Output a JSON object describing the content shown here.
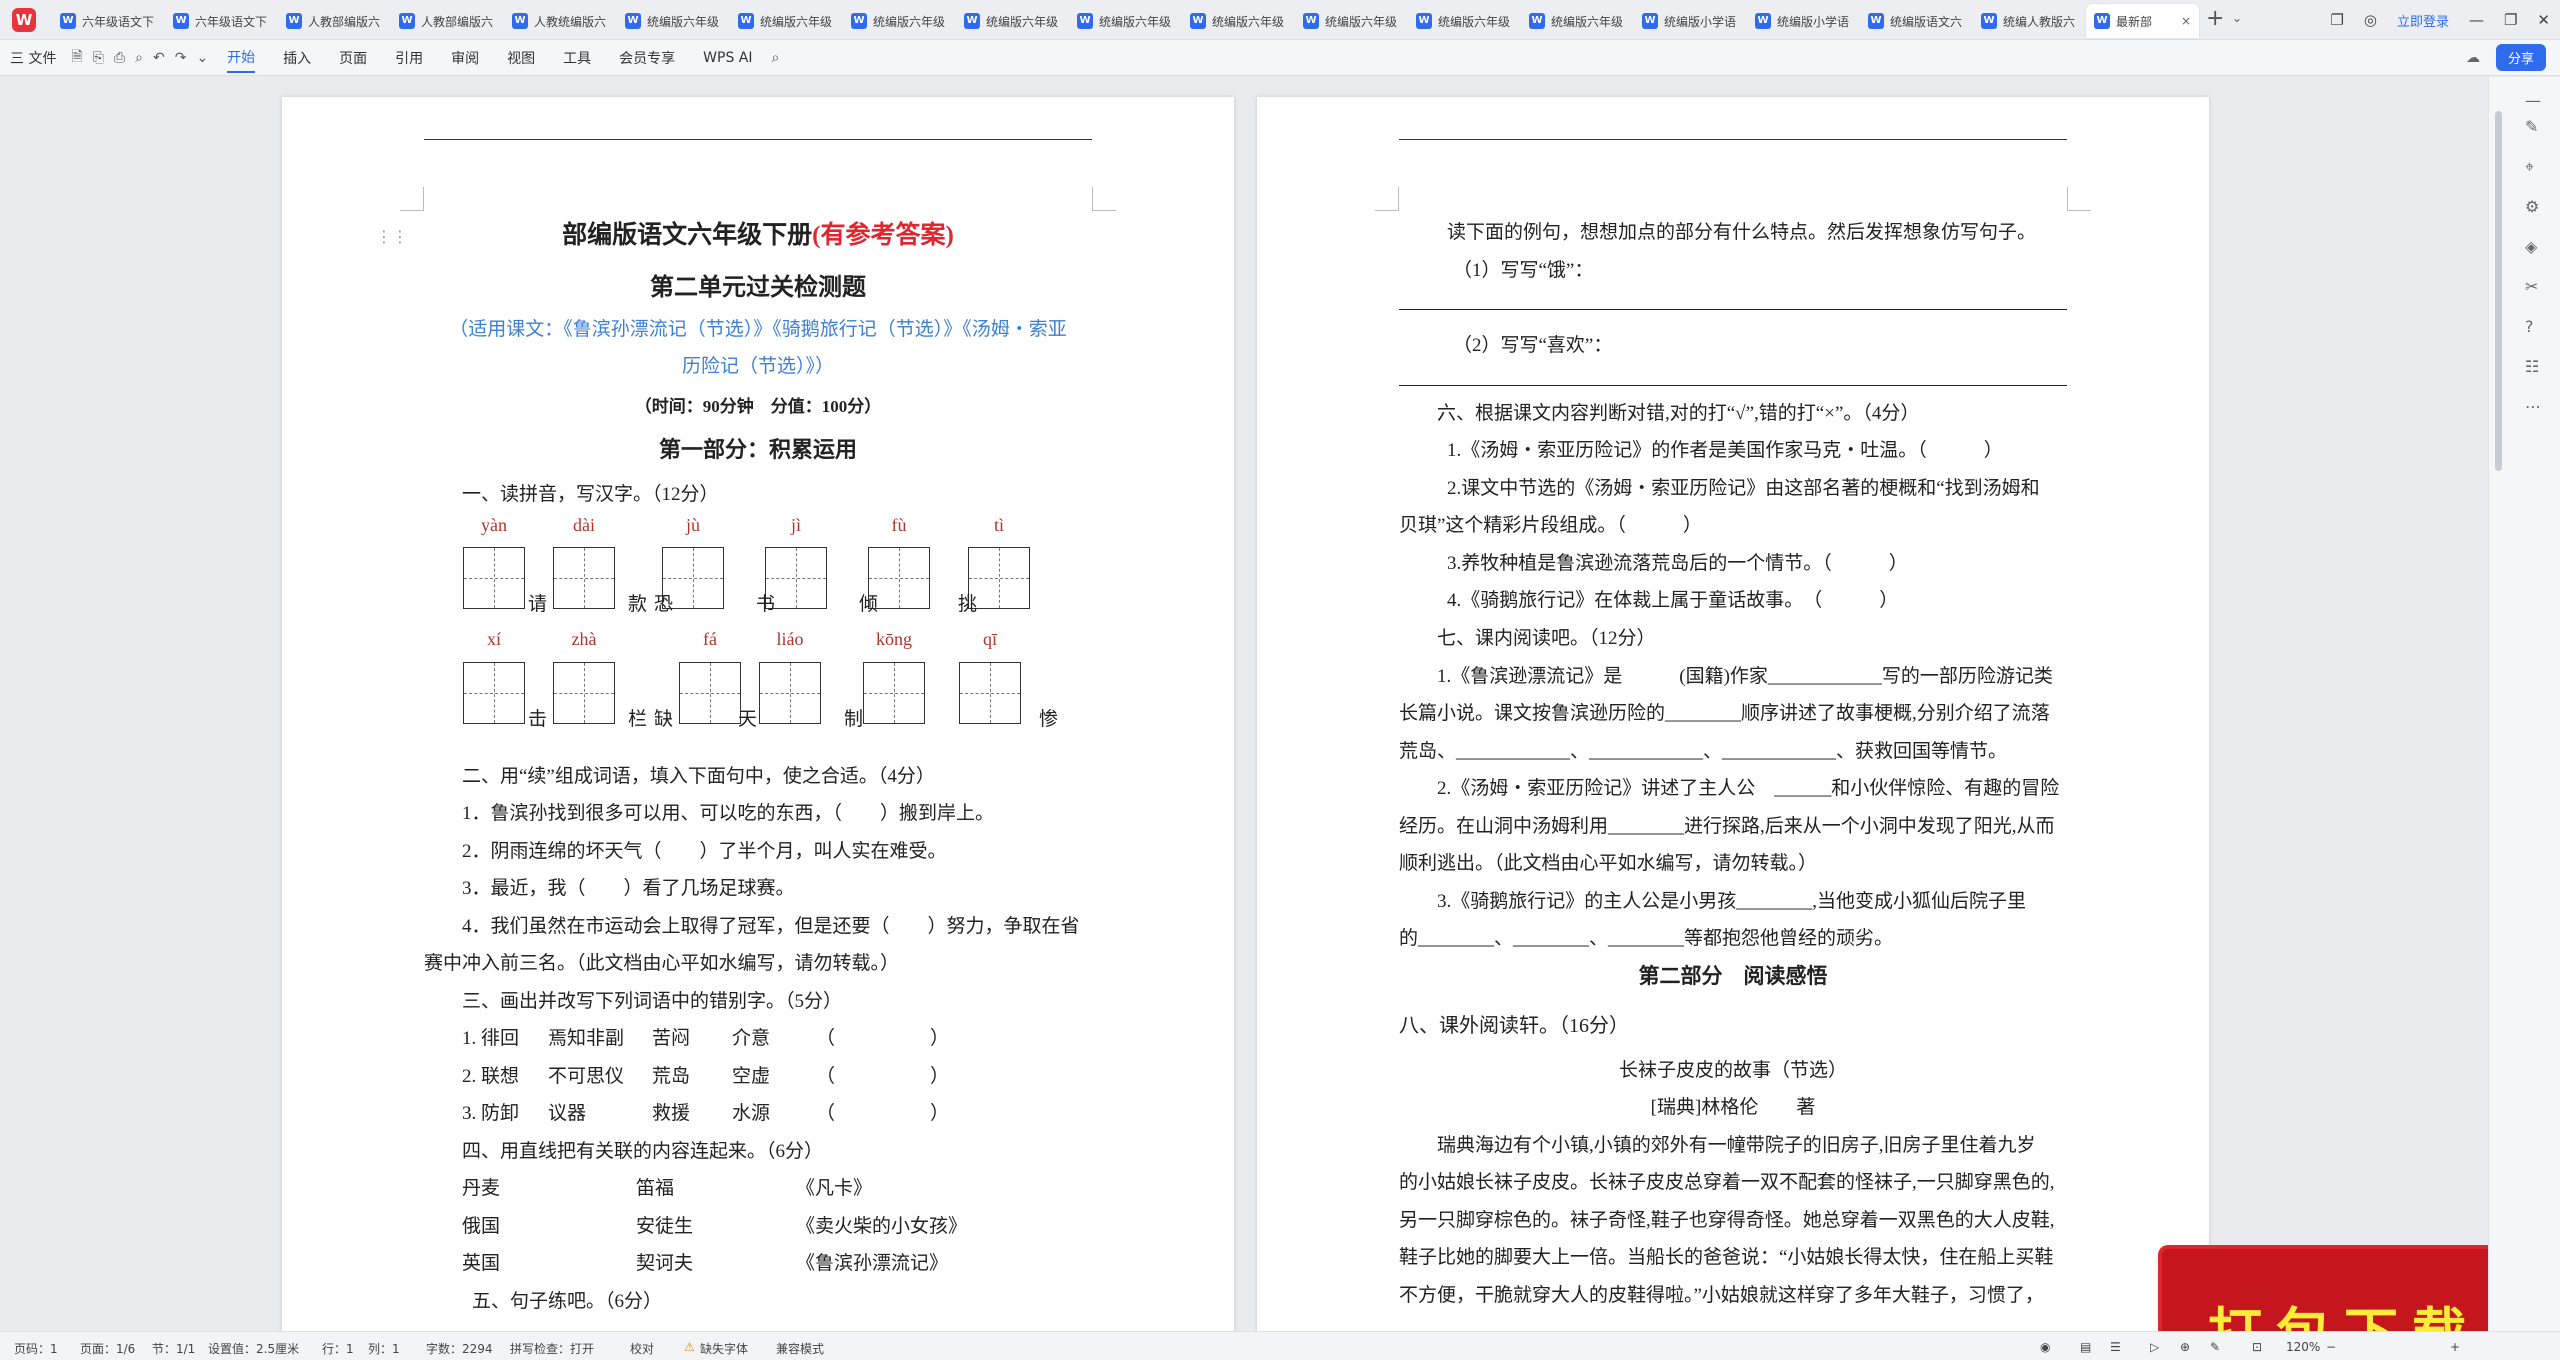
{
  "tabbar": {
    "logo": "W",
    "tabs": [
      "六年级语文下",
      "六年级语文下",
      "人教部编版六",
      "人教部编版六",
      "人教统编版六",
      "统编版六年级",
      "统编版六年级",
      "统编版六年级",
      "统编版六年级",
      "统编版六年级",
      "统编版六年级",
      "统编版六年级",
      "统编版六年级",
      "统编版六年级",
      "统编版小学语",
      "统编版小学语",
      "统编版语文六",
      "统编人教版六"
    ],
    "active_tab": "最新部",
    "login": "立即登录"
  },
  "toolbar": {
    "file": "三 文件",
    "menus": [
      "开始",
      "插入",
      "页面",
      "引用",
      "审阅",
      "视图",
      "工具",
      "会员专享"
    ],
    "wps_ai": "WPS AI",
    "share": "分享"
  },
  "page1": {
    "title_main": "部编版语文六年级下册",
    "title_red": "(有参考答案)",
    "subtitle": "第二单元过关检测题",
    "lessons_1": "（适用课文：《鲁滨孙漂流记（节选）》《骑鹅旅行记（节选）》《汤姆・索亚",
    "lessons_2": "历险记（节选）》）",
    "time": "（时间：90分钟　分值：100分）",
    "part1": "第一部分：积累运用",
    "q1": "一、读拼音，写汉字。（12分）",
    "pinyin_row1": [
      "yàn",
      "dài",
      "jù",
      "jì",
      "fù",
      "tì"
    ],
    "chars_row1": [
      "请",
      "款",
      "恐",
      "书",
      "倾",
      "挑"
    ],
    "pinyin_row2": [
      "xí",
      "zhà",
      "fá",
      "liáo",
      "kōng",
      "qī"
    ],
    "chars_row2": [
      "击",
      "栏",
      "缺",
      "天",
      "制",
      "惨"
    ],
    "q2": "二、用“续”组成词语，填入下面句中，使之合适。（4分）",
    "q2_1": "1．鲁滨孙找到很多可以用、可以吃的东西，（　　）搬到岸上。",
    "q2_2": "2．阴雨连绵的坏天气（　　）了半个月，叫人实在难受。",
    "q2_3": "3．最近，我（　　）看了几场足球赛。",
    "q2_4a": "4．我们虽然在市运动会上取得了冠军，但是还要（　　）努力，争取在省",
    "q2_4b": "赛中冲入前三名。（此文档由心平如水编写，请勿转载。）",
    "q3": "三、画出并改写下列词语中的错别字。（5分）",
    "q3_rows": [
      [
        "1. 徘回",
        "焉知非副",
        "苦闷",
        "介意",
        "（　　　　　）"
      ],
      [
        "2. 联想",
        "不可思仪",
        "荒岛",
        "空虚",
        "（　　　　　）"
      ],
      [
        "3. 防卸",
        "议器",
        "救援",
        "水源",
        "（　　　　　）"
      ]
    ],
    "q4": "四、用直线把有关联的内容连起来。（6分）",
    "q4_rows": [
      [
        "丹麦",
        "笛福",
        "《凡卡》"
      ],
      [
        "俄国",
        "安徒生",
        "《卖火柴的小女孩》"
      ],
      [
        "英国",
        "契诃夫",
        "《鲁滨孙漂流记》"
      ]
    ],
    "q5": "五、句子练吧。（6分）"
  },
  "page2": {
    "l1": "读下面的例句，想想加点的部分有什么特点。然后发挥想象仿写句子。",
    "l2": "（1）写写“饿”：",
    "l3": "（2）写写“喜欢”：",
    "q6": "六、根据课文内容判断对错,对的打“√”,错的打“×”。（4分）",
    "q6_1": "1.《汤姆・索亚历险记》的作者是美国作家马克・吐温。（　　　）",
    "q6_2a": "2.课文中节选的《汤姆・索亚历险记》由这部名著的梗概和“找到汤姆和",
    "q6_2b": "贝琪”这个精彩片段组成。（　　　）",
    "q6_3": "3.养牧种植是鲁滨逊流落荒岛后的一个情节。（　　　）",
    "q6_4": "4.《骑鹅旅行记》在体裁上属于童话故事。　（　　　）",
    "q7": "七、课内阅读吧。（12分）",
    "q7_1a": "1.《鲁滨逊漂流记》是　　　(国籍)作家____________写的一部历险游记类",
    "q7_1b": "长篇小说。课文按鲁滨逊历险的________顺序讲述了故事梗概,分别介绍了流落",
    "q7_1c": "荒岛、____________、____________、____________、获救回国等情节。",
    "q7_2a": "2.《汤姆・索亚历险记》讲述了主人公　______和小伙伴惊险、有趣的冒险",
    "q7_2b": "经历。在山洞中汤姆利用________进行探路,后来从一个小洞中发现了阳光,从而",
    "q7_2c": "顺利逃出。（此文档由心平如水编写，请勿转载。）",
    "q7_3a": "3.《骑鹅旅行记》的主人公是小男孩________,当他变成小狐仙后院子里",
    "q7_3b": "的________、________、________等都抱怨他曾经的顽劣。",
    "part2": "第二部分　阅读感悟",
    "q8": "八、课外阅读轩。（16分）",
    "story_title": "长袜子皮皮的故事（节选）",
    "author": "[瑞典]林格伦　　著",
    "p1": "瑞典海边有个小镇,小镇的郊外有一幢带院子的旧房子,旧房子里住着九岁",
    "p2": "的小姑娘长袜子皮皮。长袜子皮皮总穿着一双不配套的怪袜子,一只脚穿黑色的,",
    "p3": "另一只脚穿棕色的。袜子奇怪,鞋子也穿得奇怪。她总穿着一双黑色的大人皮鞋,",
    "p4": "鞋子比她的脚要大上一倍。当船长的爸爸说：“小姑娘长得太快，住在船上买鞋",
    "p5": "不方便，干脆就穿大人的皮鞋得啦。”小姑娘就这样穿了多年大鞋子，习惯了，"
  },
  "status": {
    "page": "页码：1",
    "pages": "页面：1/6",
    "section": "节：1/1",
    "setting": "设置值：2.5厘米",
    "row": "行：1",
    "col": "列：1",
    "words": "字数：2294",
    "spell": "拼写检查：打开",
    "proof": "校对",
    "font_missing": "缺失字体",
    "compat": "兼容模式",
    "zoom": "120%"
  },
  "banner": "打包下载",
  "colors": {
    "accent": "#2f6bed",
    "red": "#e0262e",
    "blue": "#3e7fd6"
  }
}
